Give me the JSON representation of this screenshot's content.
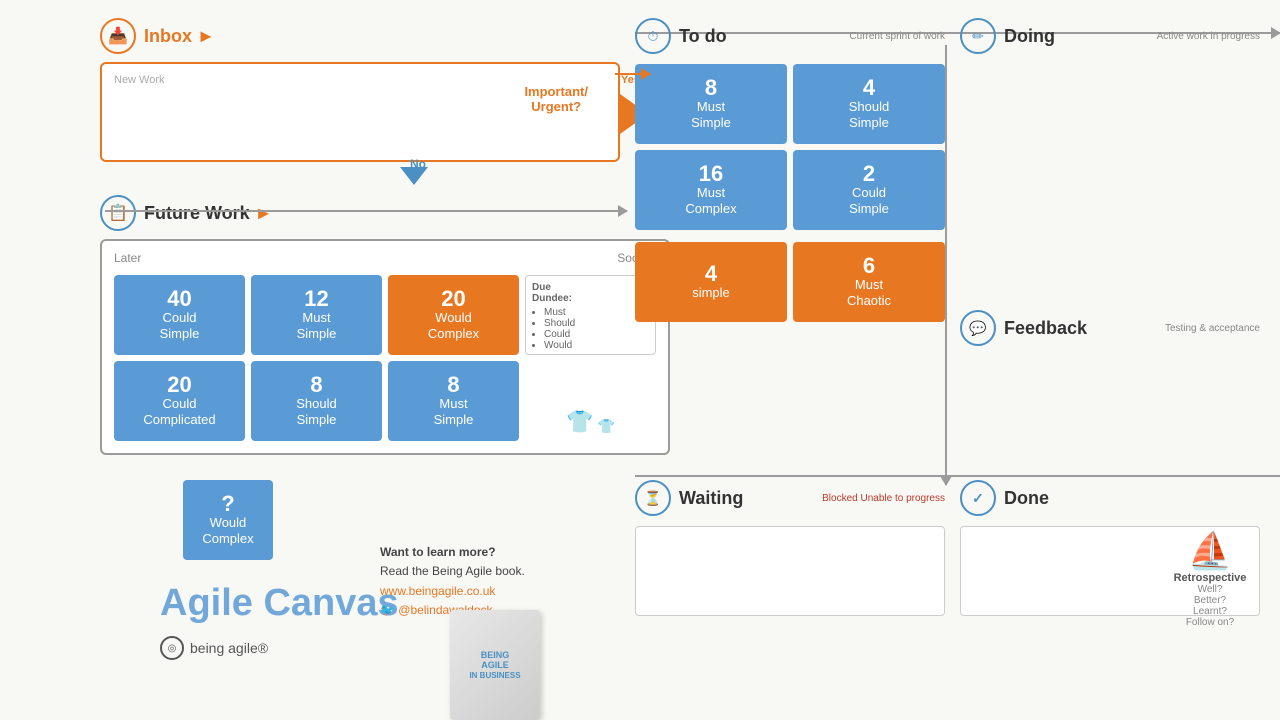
{
  "inbox": {
    "title": "Inbox",
    "arrow": "►",
    "new_work_label": "New Work",
    "important_urgent": "Important/\nUrgent?",
    "yes_label": "Yes",
    "no_label": "No"
  },
  "future_work": {
    "title": "Future Work",
    "arrow": "►",
    "later_label": "Later",
    "sooner_label": "Sooner",
    "cards": [
      {
        "num": "40",
        "line1": "Could",
        "line2": "Simple",
        "type": "blue"
      },
      {
        "num": "12",
        "line1": "Must",
        "line2": "Simple",
        "type": "blue"
      },
      {
        "num": "20",
        "line1": "Would",
        "line2": "Complex",
        "type": "orange"
      },
      {
        "num": "",
        "line1": "Due",
        "line2": "Dundee:",
        "type": "overlay"
      },
      {
        "num": "20",
        "line1": "Could",
        "line2": "Complicated",
        "type": "blue"
      },
      {
        "num": "8",
        "line1": "Should",
        "line2": "Simple",
        "type": "blue"
      },
      {
        "num": "8",
        "line1": "Must",
        "line2": "Simple",
        "type": "blue"
      },
      {
        "num": "",
        "line1": "",
        "line2": "",
        "type": "tshirt"
      }
    ],
    "would_complex_bottom": {
      "num": "?",
      "line1": "Would",
      "line2": "Complex"
    }
  },
  "todo": {
    "title": "To do",
    "subtitle": "Current sprint of work",
    "cards": [
      {
        "num": "8",
        "line1": "Must",
        "line2": "Simple",
        "type": "blue"
      },
      {
        "num": "4",
        "line1": "Should",
        "line2": "Simple",
        "type": "blue"
      },
      {
        "num": "16",
        "line1": "Must",
        "line2": "Complex",
        "type": "blue"
      },
      {
        "num": "2",
        "line1": "Could",
        "line2": "Simple",
        "type": "blue"
      },
      {
        "num": "4",
        "line1": "simple",
        "line2": "",
        "type": "orange"
      },
      {
        "num": "6",
        "line1": "Must",
        "line2": "Chaotic",
        "type": "orange"
      }
    ]
  },
  "doing": {
    "title": "Doing",
    "subtitle": "Active work\nin progress"
  },
  "feedback": {
    "title": "Feedback",
    "subtitle": "Testing &\nacceptance"
  },
  "waiting": {
    "title": "Waiting",
    "subtitle": "Blocked\nUnable to progress"
  },
  "done": {
    "title": "Done",
    "retro": {
      "title": "Retrospective",
      "items": [
        "Well?",
        "Better?",
        "Learnt?",
        "Follow on?"
      ]
    }
  },
  "agile_canvas": {
    "title": "Agile Canvas"
  },
  "being_agile": {
    "label": "being agile®"
  },
  "learn_more": {
    "line1": "Want to learn more?",
    "line2": "Read the Being Agile book.",
    "line3": "www.beingagile.co.uk",
    "line4": "@belindawaldock"
  },
  "book": {
    "line1": "BEING",
    "line2": "AGILE",
    "line3": "IN BUSINESS"
  },
  "icons": {
    "inbox": "📥",
    "future_work": "📋",
    "todo": "⏱",
    "doing": "✏️",
    "feedback": "💬",
    "waiting": "⏳",
    "done": "✓",
    "being_agile": "◎",
    "boat": "⛵"
  }
}
